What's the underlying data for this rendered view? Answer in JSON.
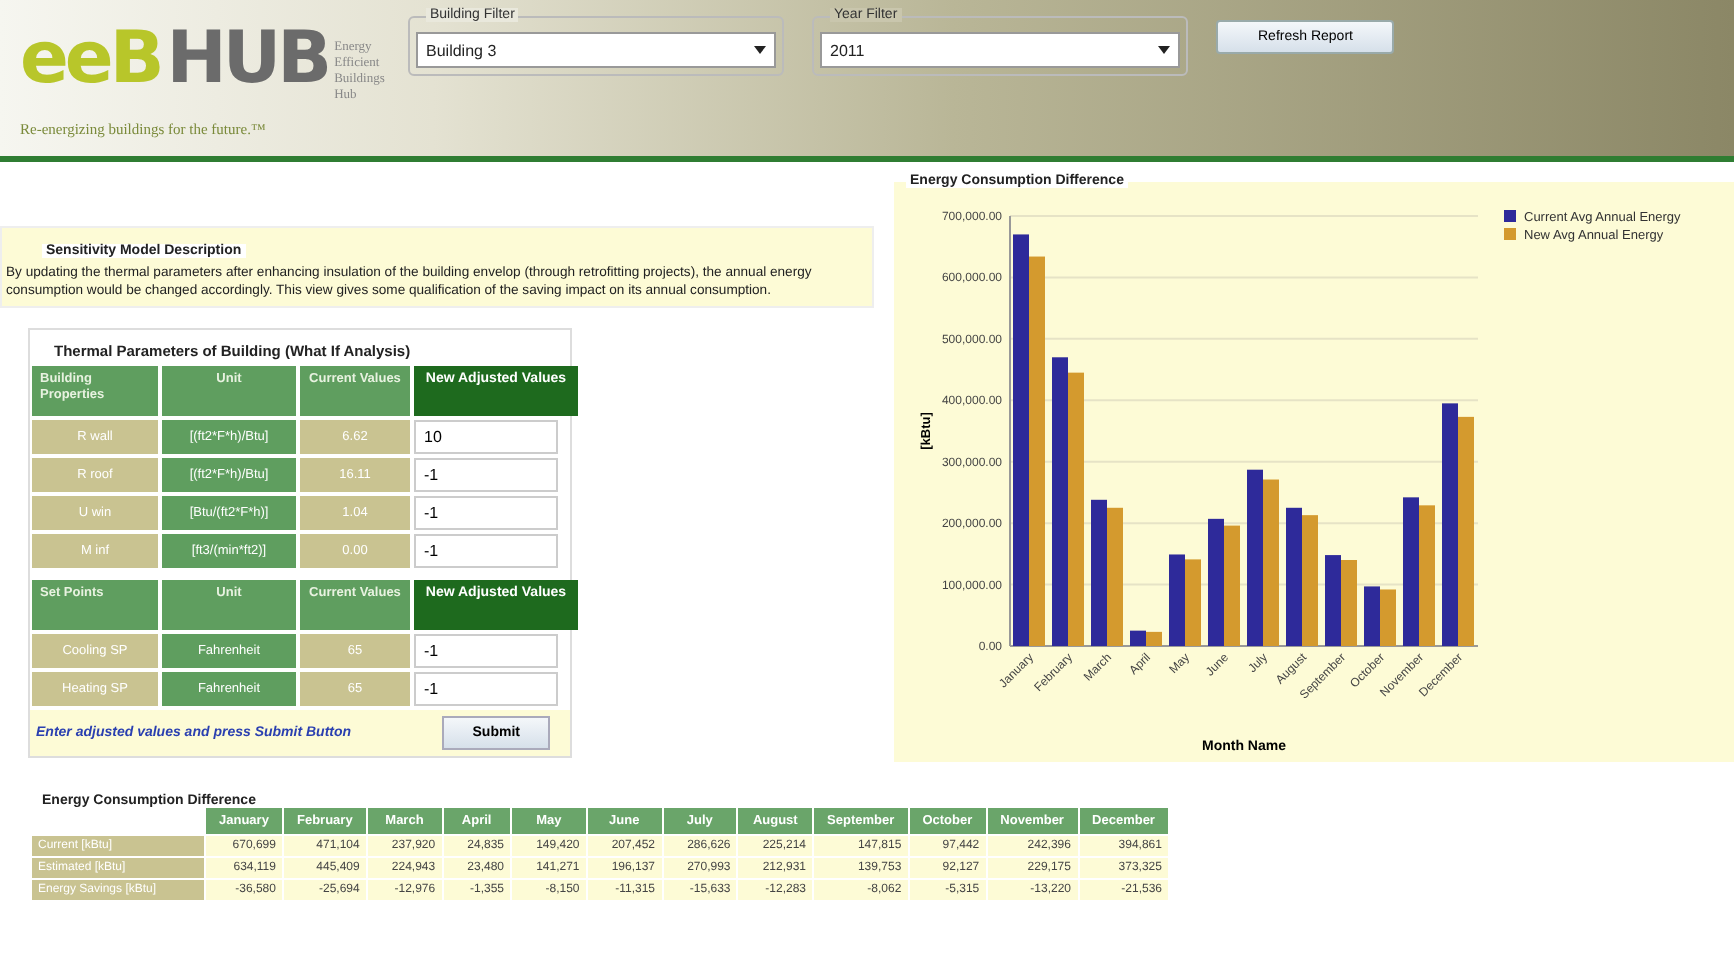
{
  "header": {
    "logo": {
      "mark_1": "eeB",
      "mark_2": "HUB",
      "subtitle": [
        "Energy",
        "Efficient",
        "Buildings",
        "Hub"
      ],
      "tagline": "Re-energizing buildings for the future.™"
    },
    "filters": [
      {
        "label": "Building Filter",
        "value": "Building 3"
      },
      {
        "label": "Year Filter",
        "value": "2011"
      }
    ],
    "refresh_button": "Refresh Report"
  },
  "description": {
    "title": "Sensitivity Model Description",
    "text": "By updating the thermal parameters after enhancing insulation of the building envelop (through retrofitting projects), the annual energy consumption would be changed accordingly. This view gives some qualification of the saving impact on its annual consumption."
  },
  "thermal": {
    "title": "Thermal Parameters of Building  (What If Analysis)",
    "sections": [
      {
        "columns": [
          "Building Properties",
          "Unit",
          "Current Values",
          "New Adjusted Values"
        ],
        "rows": [
          {
            "property": "R wall",
            "unit": "[(ft2*F*h)/Btu]",
            "current": "6.62",
            "new_value": "10"
          },
          {
            "property": "R roof",
            "unit": "[(ft2*F*h)/Btu]",
            "current": "16.11",
            "new_value": "-1"
          },
          {
            "property": "U win",
            "unit": "[Btu/(ft2*F*h)]",
            "current": "1.04",
            "new_value": "-1"
          },
          {
            "property": "M inf",
            "unit": "[ft3/(min*ft2)]",
            "current": "0.00",
            "new_value": "-1"
          }
        ]
      },
      {
        "columns": [
          "Set Points",
          "Unit",
          "Current Values",
          "New Adjusted Values"
        ],
        "rows": [
          {
            "property": "Cooling SP",
            "unit": "Fahrenheit",
            "current": "65",
            "new_value": "-1"
          },
          {
            "property": "Heating SP",
            "unit": "Fahrenheit",
            "current": "65",
            "new_value": "-1"
          }
        ]
      }
    ],
    "hint": "Enter adjusted values and press Submit Button",
    "submit_button": "Submit"
  },
  "chart_panel": {
    "title": "Energy Consumption Difference",
    "chart_data": {
      "type": "bar",
      "xlabel": "Month Name",
      "ylabel": "[kBtu]",
      "categories": [
        "January",
        "February",
        "March",
        "April",
        "May",
        "June",
        "July",
        "August",
        "September",
        "October",
        "November",
        "December"
      ],
      "series": [
        {
          "name": "Current Avg Annual Energy",
          "color": "#2e2a9a",
          "values": [
            670000,
            470000,
            238000,
            25000,
            149000,
            207000,
            287000,
            225000,
            148000,
            97000,
            242000,
            395000
          ]
        },
        {
          "name": "New Avg Annual Energy",
          "color": "#d49a2e",
          "values": [
            634000,
            445000,
            225000,
            23000,
            141000,
            196000,
            271000,
            213000,
            140000,
            92000,
            229000,
            373000
          ]
        }
      ],
      "grid": true,
      "legend": true,
      "ylim": [
        0,
        700000
      ],
      "yticks": [
        {
          "value": 0,
          "label": "0.00"
        },
        {
          "value": 100000,
          "label": "100,000.00"
        },
        {
          "value": 200000,
          "label": "200,000.00"
        },
        {
          "value": 300000,
          "label": "300,000.00"
        },
        {
          "value": 400000,
          "label": "400,000.00"
        },
        {
          "value": 500000,
          "label": "500,000.00"
        },
        {
          "value": 600000,
          "label": "600,000.00"
        },
        {
          "value": 700000,
          "label": "700,000.00"
        }
      ]
    }
  },
  "table": {
    "title": "Energy Consumption Difference",
    "columns": [
      "January",
      "February",
      "March",
      "April",
      "May",
      "June",
      "July",
      "August",
      "September",
      "October",
      "November",
      "December"
    ],
    "rows": [
      {
        "label": "Current [kBtu]",
        "values": [
          "670,699",
          "471,104",
          "237,920",
          "24,835",
          "149,420",
          "207,452",
          "286,626",
          "225,214",
          "147,815",
          "97,442",
          "242,396",
          "394,861"
        ]
      },
      {
        "label": "Estimated [kBtu]",
        "values": [
          "634,119",
          "445,409",
          "224,943",
          "23,480",
          "141,271",
          "196,137",
          "270,993",
          "212,931",
          "139,753",
          "92,127",
          "229,175",
          "373,325"
        ]
      },
      {
        "label": "Energy Savings [kBtu]",
        "values": [
          "-36,580",
          "-25,694",
          "-12,976",
          "-1,355",
          "-8,150",
          "-11,315",
          "-15,633",
          "-12,283",
          "-8,062",
          "-5,315",
          "-13,220",
          "-21,536"
        ]
      }
    ]
  }
}
